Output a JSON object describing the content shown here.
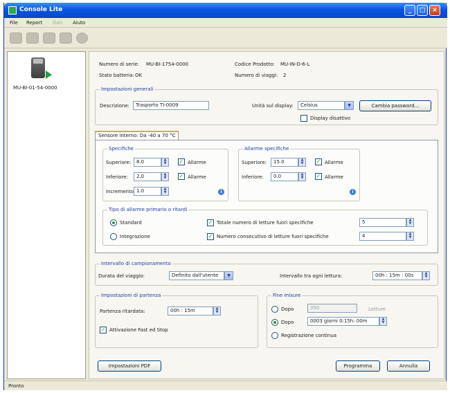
{
  "window": {
    "title": "Console Lite"
  },
  "menu": [
    {
      "label": "File",
      "enabled": true
    },
    {
      "label": "Report",
      "enabled": true
    },
    {
      "label": "Dati",
      "enabled": false
    },
    {
      "label": "Aiuto",
      "enabled": true
    }
  ],
  "toolbar": {
    "icons": [
      "save-icon",
      "print-icon",
      "copy-icon",
      "export-icon",
      "refresh-icon"
    ]
  },
  "sidebar": {
    "device_label": "MU-BI-01-54-0000"
  },
  "info": {
    "serial_label": "Numero di serie:",
    "serial_value": "MU-BI-1754-0000",
    "product_label": "Codice Prodotto:",
    "product_value": "MU-IN-D-6-L",
    "battery_label": "Stato batteria:",
    "battery_value": "OK",
    "trips_label": "Numero di viaggi:",
    "trips_value": "2"
  },
  "general": {
    "title": "Impostazioni generali",
    "description_label": "Descrizione:",
    "description_value": "Trasporto TI-0009",
    "unit_label": "Unità sul display:",
    "unit_value": "Celsius",
    "password_button": "Cambia password...",
    "display_disabled_label": "Display disattivo",
    "display_disabled": false
  },
  "sensor_tab": {
    "label": "Sensore interno: Da -40 a 70 °C"
  },
  "specifications": {
    "title": "Specifiche",
    "upper_label": "Superiore:",
    "upper_value": "8.0",
    "lower_label": "Inferiore:",
    "lower_value": "2.0",
    "increment_label": "Incremento:",
    "increment_value": "1.0",
    "alarm_label": "Allarme",
    "upper_alarm": true,
    "lower_alarm": true
  },
  "alarm_spec": {
    "title": "Allarme specifiche",
    "upper_label": "Superiore:",
    "upper_value": "15.0",
    "lower_label": "Inferiore:",
    "lower_value": "0.0",
    "alarm_label": "Allarme",
    "upper_alarm": true,
    "lower_alarm": true
  },
  "alarm_type": {
    "title": "Tipo di allarme primario o ritardi",
    "standard_label": "Standard",
    "integration_label": "Integrazione",
    "selected": "standard",
    "total_label": "Totale numero di letture fuori specifiche",
    "total_value": "5",
    "consecutive_label": "Numero consecutivo di letture fuori specifiche",
    "consecutive_value": "4",
    "total_checked": true,
    "consecutive_checked": true
  },
  "sampling": {
    "title": "Intervallo di campionamento",
    "trip_label": "Durata del viaggio:",
    "trip_value": "Definito dall'utente",
    "interval_label": "Intervallo tra ogni lettura:",
    "interval_value": "00h : 15m : 00s"
  },
  "start": {
    "title": "Impostazioni di partenza",
    "delay_label": "Partenza ritardata:",
    "delay_value": "00h : 15m",
    "start_stop_label": "Attivazione Fast ed Stop",
    "start_stop": true
  },
  "end": {
    "title": "Fine misure",
    "option1_label": "Dopo",
    "option1_value": "350",
    "option1_unit": "Letture",
    "option2_label": "Dopo",
    "option2_value": "0003 giorni 0:15h: 00m",
    "option3_label": "Registrazione continua",
    "selected": "option2"
  },
  "footer": {
    "pdf_button": "Impostazioni PDF",
    "program_button": "Programma",
    "cancel_button": "Annulla"
  },
  "statusbar": {
    "text": "Pronto"
  }
}
